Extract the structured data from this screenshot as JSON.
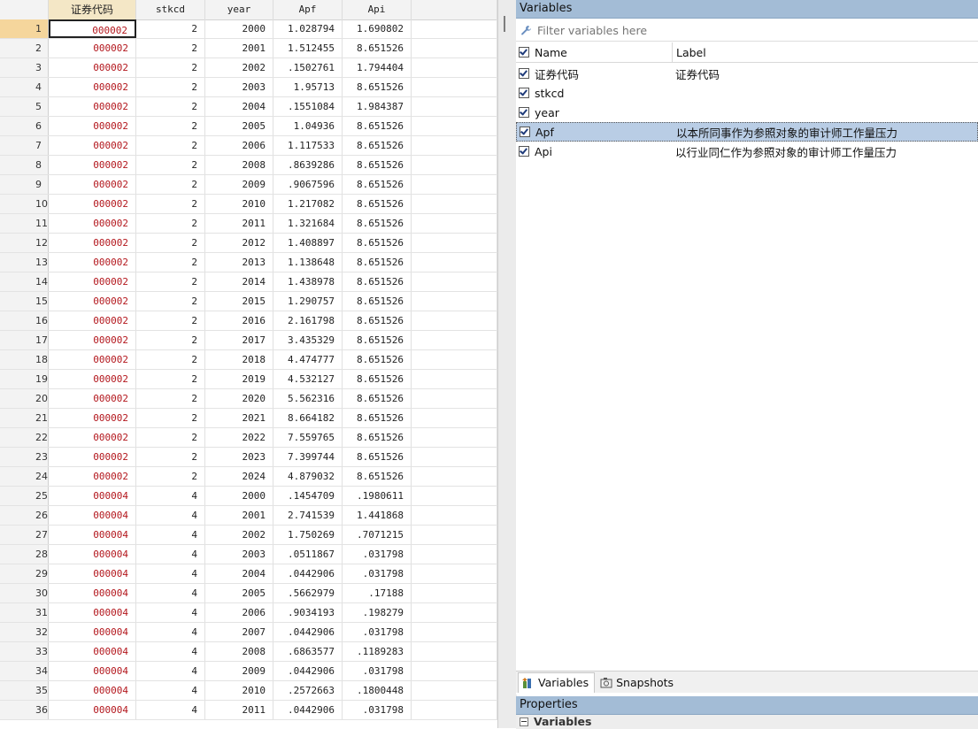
{
  "grid": {
    "columns": [
      "",
      "证券代码",
      "stkcd",
      "year",
      "Apf",
      "Api",
      ""
    ],
    "rows": [
      [
        "1",
        "000002",
        "2",
        "2000",
        "1.028794",
        "1.690802"
      ],
      [
        "2",
        "000002",
        "2",
        "2001",
        "1.512455",
        "8.651526"
      ],
      [
        "3",
        "000002",
        "2",
        "2002",
        ".1502761",
        "1.794404"
      ],
      [
        "4",
        "000002",
        "2",
        "2003",
        "1.95713",
        "8.651526"
      ],
      [
        "5",
        "000002",
        "2",
        "2004",
        ".1551084",
        "1.984387"
      ],
      [
        "6",
        "000002",
        "2",
        "2005",
        "1.04936",
        "8.651526"
      ],
      [
        "7",
        "000002",
        "2",
        "2006",
        "1.117533",
        "8.651526"
      ],
      [
        "8",
        "000002",
        "2",
        "2008",
        ".8639286",
        "8.651526"
      ],
      [
        "9",
        "000002",
        "2",
        "2009",
        ".9067596",
        "8.651526"
      ],
      [
        "10",
        "000002",
        "2",
        "2010",
        "1.217082",
        "8.651526"
      ],
      [
        "11",
        "000002",
        "2",
        "2011",
        "1.321684",
        "8.651526"
      ],
      [
        "12",
        "000002",
        "2",
        "2012",
        "1.408897",
        "8.651526"
      ],
      [
        "13",
        "000002",
        "2",
        "2013",
        "1.138648",
        "8.651526"
      ],
      [
        "14",
        "000002",
        "2",
        "2014",
        "1.438978",
        "8.651526"
      ],
      [
        "15",
        "000002",
        "2",
        "2015",
        "1.290757",
        "8.651526"
      ],
      [
        "16",
        "000002",
        "2",
        "2016",
        "2.161798",
        "8.651526"
      ],
      [
        "17",
        "000002",
        "2",
        "2017",
        "3.435329",
        "8.651526"
      ],
      [
        "18",
        "000002",
        "2",
        "2018",
        "4.474777",
        "8.651526"
      ],
      [
        "19",
        "000002",
        "2",
        "2019",
        "4.532127",
        "8.651526"
      ],
      [
        "20",
        "000002",
        "2",
        "2020",
        "5.562316",
        "8.651526"
      ],
      [
        "21",
        "000002",
        "2",
        "2021",
        "8.664182",
        "8.651526"
      ],
      [
        "22",
        "000002",
        "2",
        "2022",
        "7.559765",
        "8.651526"
      ],
      [
        "23",
        "000002",
        "2",
        "2023",
        "7.399744",
        "8.651526"
      ],
      [
        "24",
        "000002",
        "2",
        "2024",
        "4.879032",
        "8.651526"
      ],
      [
        "25",
        "000004",
        "4",
        "2000",
        ".1454709",
        ".1980611"
      ],
      [
        "26",
        "000004",
        "4",
        "2001",
        "2.741539",
        "1.441868"
      ],
      [
        "27",
        "000004",
        "4",
        "2002",
        "1.750269",
        ".7071215"
      ],
      [
        "28",
        "000004",
        "4",
        "2003",
        ".0511867",
        ".031798"
      ],
      [
        "29",
        "000004",
        "4",
        "2004",
        ".0442906",
        ".031798"
      ],
      [
        "30",
        "000004",
        "4",
        "2005",
        ".5662979",
        ".17188"
      ],
      [
        "31",
        "000004",
        "4",
        "2006",
        ".9034193",
        ".198279"
      ],
      [
        "32",
        "000004",
        "4",
        "2007",
        ".0442906",
        ".031798"
      ],
      [
        "33",
        "000004",
        "4",
        "2008",
        ".6863577",
        ".1189283"
      ],
      [
        "34",
        "000004",
        "4",
        "2009",
        ".0442906",
        ".031798"
      ],
      [
        "35",
        "000004",
        "4",
        "2010",
        ".2572663",
        ".1800448"
      ],
      [
        "36",
        "000004",
        "4",
        "2011",
        ".0442906",
        ".031798"
      ]
    ]
  },
  "variables": {
    "title": "Variables",
    "filter_placeholder": "Filter variables here",
    "header_name": "Name",
    "header_label": "Label",
    "items": [
      {
        "name": "证券代码",
        "label": "证券代码"
      },
      {
        "name": "stkcd",
        "label": ""
      },
      {
        "name": "year",
        "label": ""
      },
      {
        "name": "Apf",
        "label": "以本所同事作为参照对象的审计师工作量压力"
      },
      {
        "name": "Api",
        "label": "以行业同仁作为参照对象的审计师工作量压力"
      }
    ]
  },
  "tabs": {
    "variables": "Variables",
    "snapshots": "Snapshots"
  },
  "properties": {
    "title": "Properties",
    "section": "Variables"
  }
}
